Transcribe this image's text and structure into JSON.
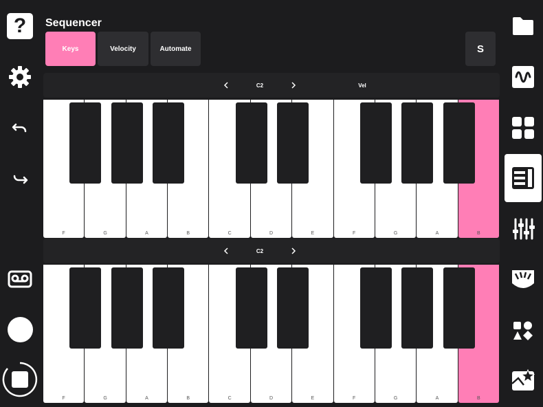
{
  "header": {
    "title": "Sequencer"
  },
  "tabs": [
    {
      "label": "Keys",
      "active": true
    },
    {
      "label": "Velocity",
      "active": false
    },
    {
      "label": "Automate",
      "active": false
    }
  ],
  "solo_button": {
    "label": "S"
  },
  "keyboards": [
    {
      "octave_label": "C2",
      "extra_label": "Vel"
    },
    {
      "octave_label": "C2",
      "extra_label": ""
    }
  ],
  "white_key_labels": [
    "F",
    "G",
    "A",
    "B",
    "C",
    "D",
    "E",
    "F",
    "G",
    "A",
    "B"
  ],
  "highlighted_key_index": 10,
  "left_toolbar": [
    "help-icon",
    "settings-gear-icon",
    "undo-icon",
    "redo-icon",
    "record-tape-icon",
    "record-circle-icon",
    "stop-square-icon"
  ],
  "right_toolbar": [
    "folder-icon",
    "waveform-icon",
    "grid-pads-icon",
    "piano-keys-icon",
    "mixer-sliders-icon",
    "tuner-icon",
    "shapes-icon",
    "presets-star-icon"
  ],
  "right_toolbar_active_index": 3,
  "colors": {
    "accent": "#ff7eb6",
    "background": "#1c1c1e",
    "panel": "#2e2e31"
  }
}
